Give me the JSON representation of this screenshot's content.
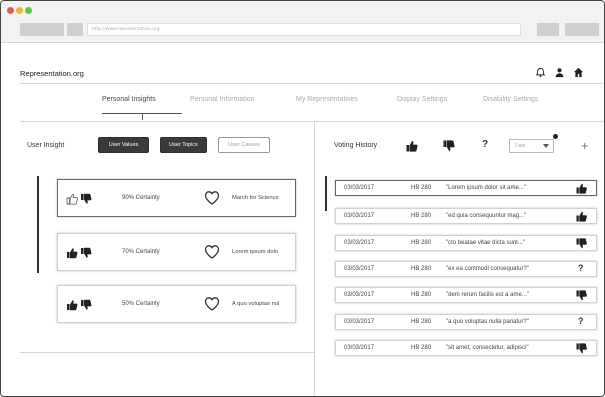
{
  "browser": {
    "url": "http://www.representation.org"
  },
  "header": {
    "site_title": "Representation.org",
    "icons": [
      "bell-icon",
      "user-icon",
      "home-icon"
    ]
  },
  "tabs": [
    {
      "label": "Personal Insights",
      "active": true
    },
    {
      "label": "Personal Information",
      "active": false
    },
    {
      "label": "My Representatives",
      "active": false
    },
    {
      "label": "Display Settings",
      "active": false
    },
    {
      "label": "Disability Settings",
      "active": false
    }
  ],
  "insights": {
    "label": "User Insight",
    "filters": [
      {
        "label": "User Values",
        "active": true
      },
      {
        "label": "User Topics",
        "active": true
      },
      {
        "label": "User Causes",
        "active": false
      }
    ],
    "cards": [
      {
        "certainty": "90% Certainty",
        "cause": "March for Science",
        "selected": true
      },
      {
        "certainty": "70% Certainty",
        "cause": "Lorem ipsum dolo",
        "selected": false
      },
      {
        "certainty": "50% Certainty",
        "cause": "A quo voluptas nul",
        "selected": false
      }
    ]
  },
  "voting": {
    "label": "Voting History",
    "date_placeholder": "Date",
    "plus": "+",
    "question": "?",
    "rows": [
      {
        "date": "03/03/2017",
        "bill": "HB 280",
        "text": "\"Lorem ipsum dolor sit ame...\"",
        "vote": "up",
        "selected": true
      },
      {
        "date": "03/03/2017",
        "bill": "HB 280",
        "text": "\"ed quia consequuntur mag...\"",
        "vote": "up",
        "selected": false
      },
      {
        "date": "03/03/2017",
        "bill": "HB 280",
        "text": "\"cto beatae vitae dicta sunt...\"",
        "vote": "down",
        "selected": false
      },
      {
        "date": "03/03/2017",
        "bill": "HB 280",
        "text": "\"ex ea commodi consequatur?\"",
        "vote": "unsure",
        "selected": false
      },
      {
        "date": "03/03/2017",
        "bill": "HB 280",
        "text": "\"dem rerum facilis est a ame...\"",
        "vote": "down",
        "selected": false
      },
      {
        "date": "03/03/2017",
        "bill": "HB 280",
        "text": "\"a quo voluptas nulla pariatur?\"",
        "vote": "unsure",
        "selected": false
      },
      {
        "date": "03/03/2017",
        "bill": "HB 280",
        "text": "\"sit amet, consectetur, adipisci\"",
        "vote": "down",
        "selected": false
      }
    ]
  }
}
